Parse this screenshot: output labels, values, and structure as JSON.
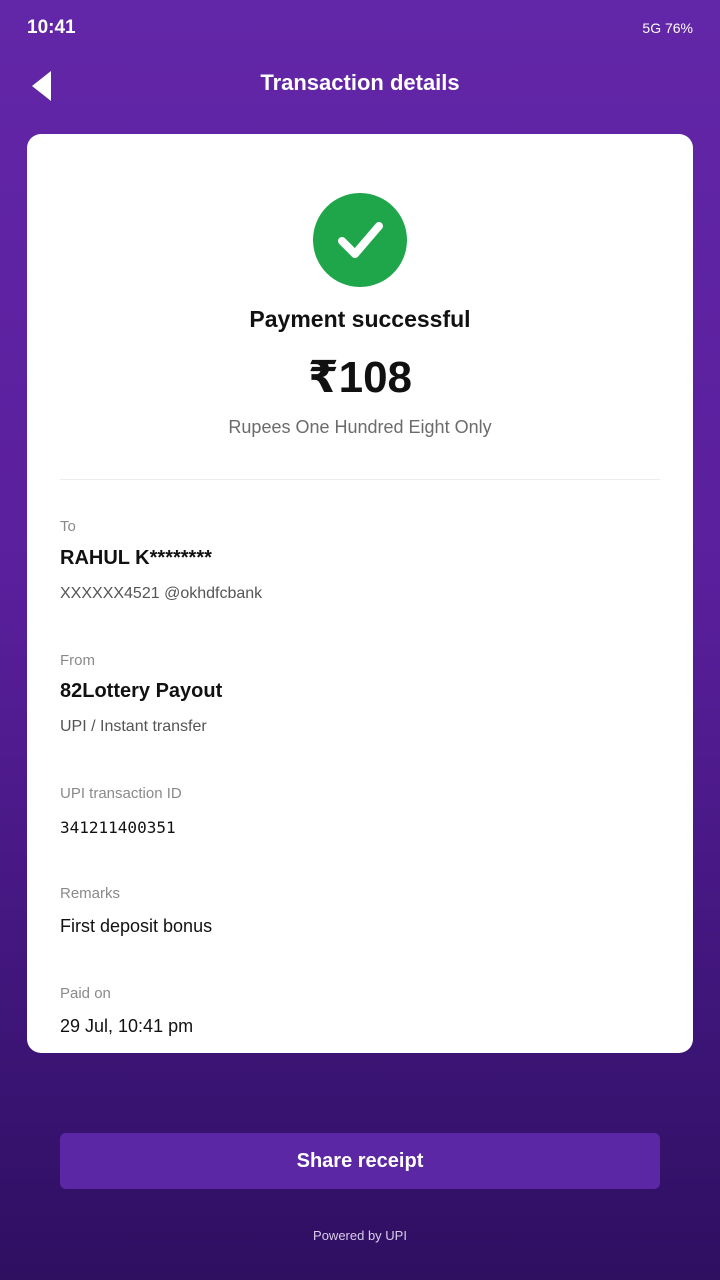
{
  "status_bar": {
    "time": "10:41",
    "right": "5G 76%"
  },
  "header": {
    "title": "Transaction details",
    "back_icon": "back-arrow-icon"
  },
  "payment": {
    "status_icon": "check-circle-icon",
    "status_color": "#1fa64a",
    "status_text": "Payment successful",
    "amount": "₹108",
    "amount_words": "Rupees One Hundred Eight Only"
  },
  "details": {
    "to": {
      "label": "To",
      "name": "RAHUL K********",
      "handle": "XXXXXX4521 @okhdfcbank"
    },
    "from": {
      "label": "From",
      "name": "82Lottery Payout",
      "method": "UPI / Instant transfer"
    },
    "txn": {
      "label": "UPI transaction ID",
      "value": "341211400351"
    },
    "remarks": {
      "label": "Remarks",
      "value": "First deposit bonus"
    },
    "paid_on": {
      "label": "Paid on",
      "value": "29 Jul, 10:41 pm"
    }
  },
  "actions": {
    "share_label": "Share receipt"
  },
  "footer": {
    "powered_by": "Powered by UPI"
  },
  "colors": {
    "background": "#5a1f9c",
    "button": "#5b27a4",
    "card": "#ffffff"
  }
}
